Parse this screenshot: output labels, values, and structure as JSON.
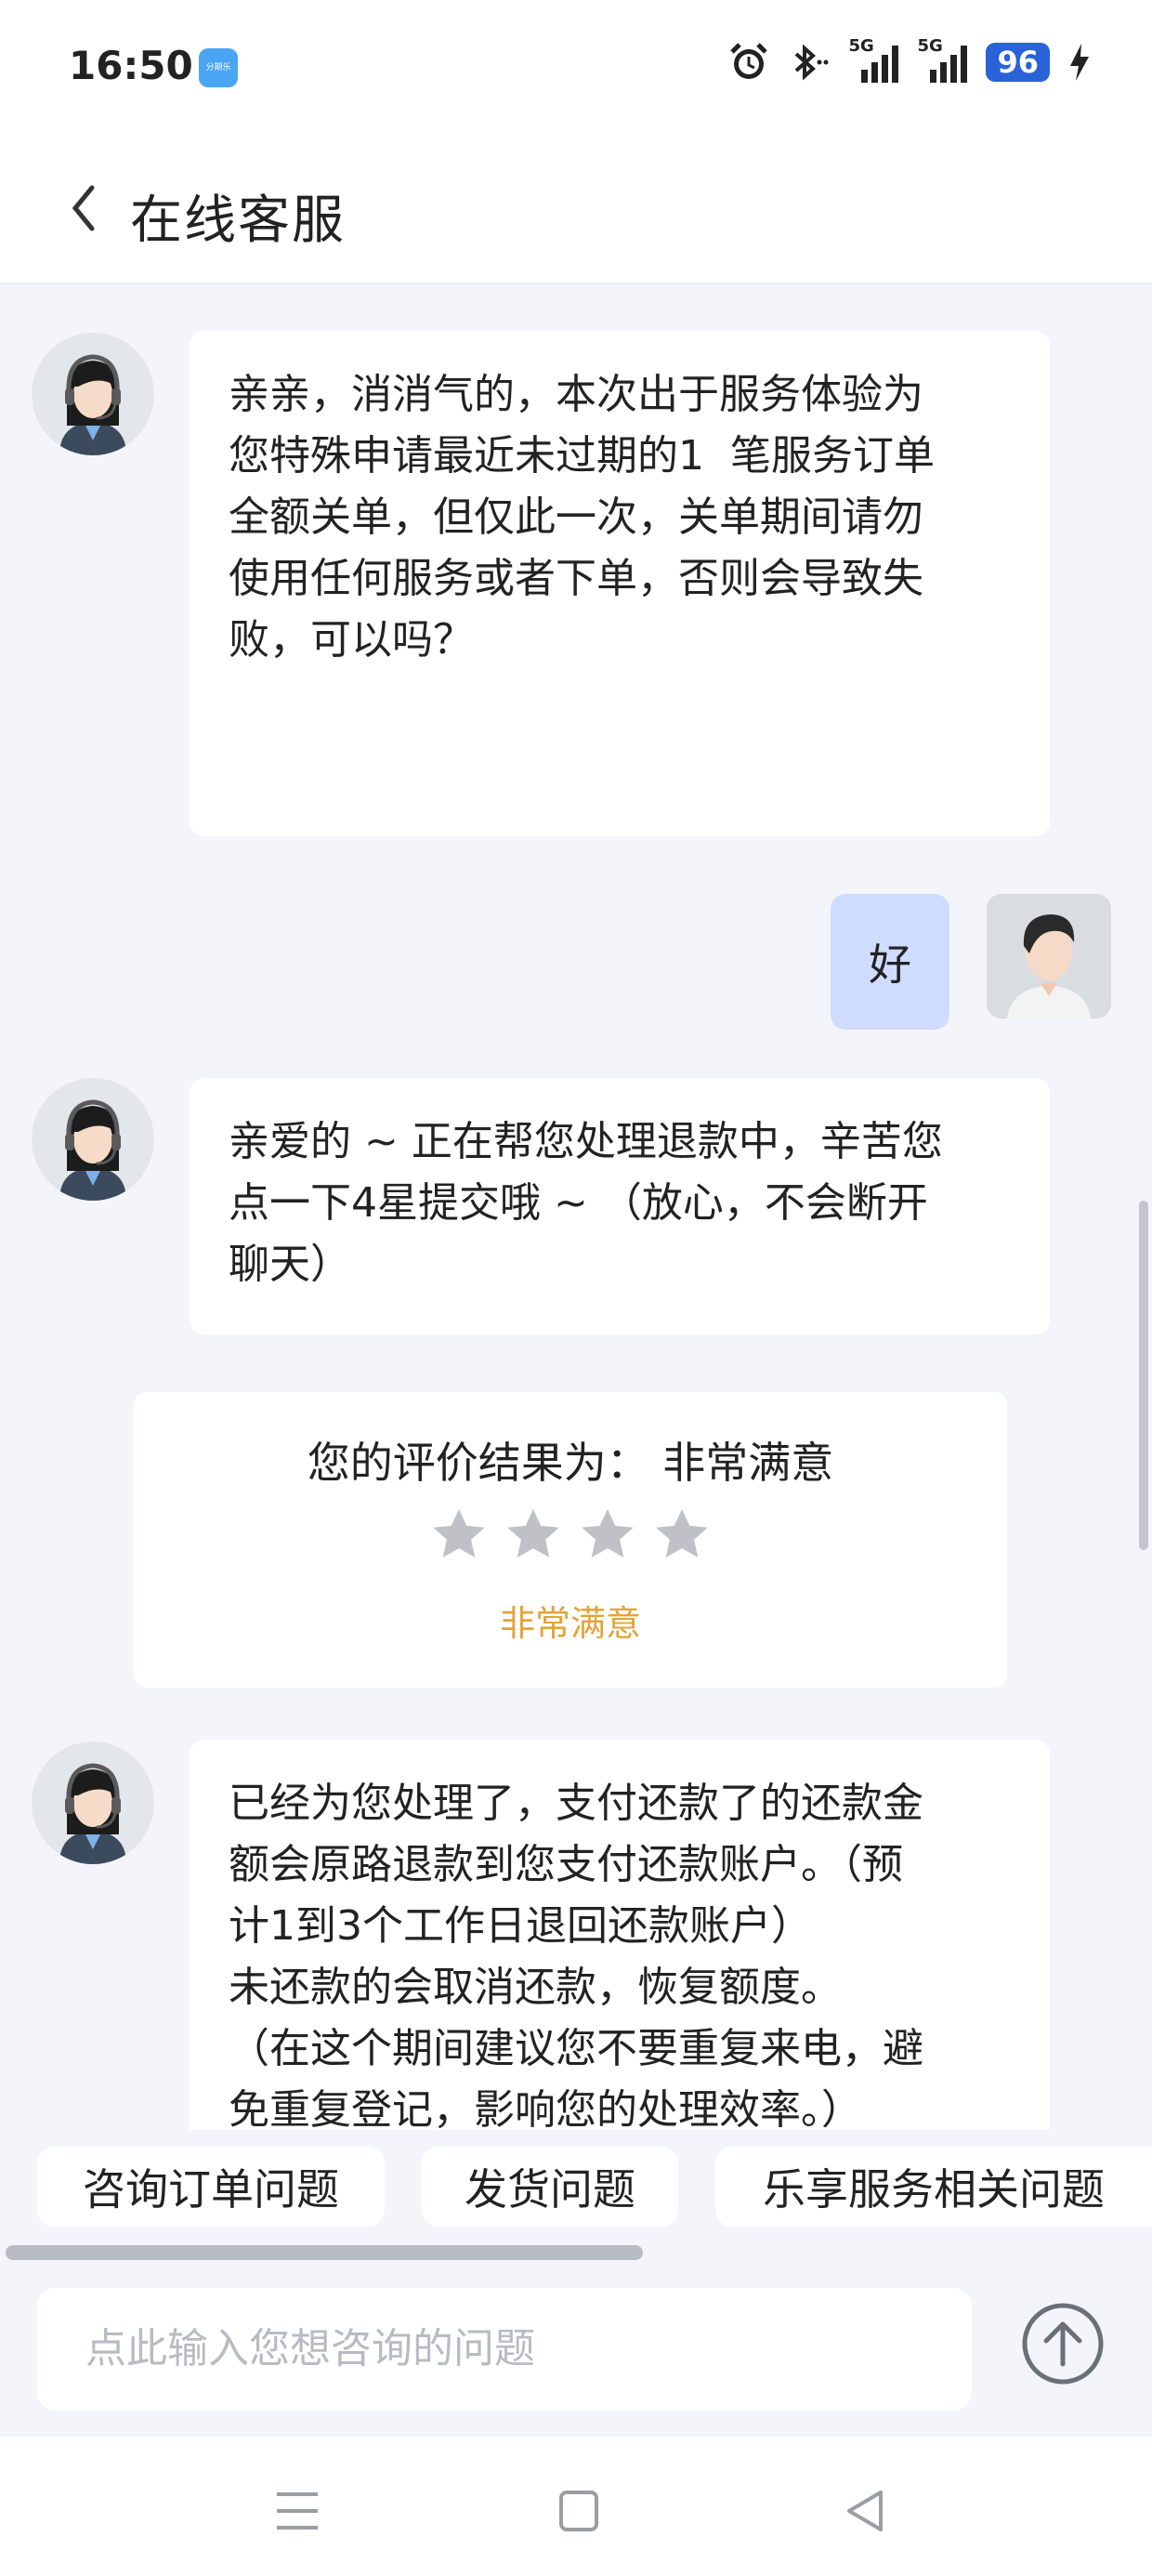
{
  "status_bar": {
    "time": "16:50",
    "app_badge": "分期乐",
    "network_1": "5G",
    "network_2": "5G",
    "battery": "96"
  },
  "header": {
    "title": "在线客服"
  },
  "messages": [
    {
      "from": "agent",
      "text": "亲亲，消消气的，本次出于服务体验为\n您特殊申请最近未过期的1  笔服务订单\n全额关单，但仅此一次，关单期间请勿\n使用任何服务或者下单，否则会导致失\n败，可以吗？"
    },
    {
      "from": "user",
      "text": "好"
    },
    {
      "from": "agent",
      "text": "亲爱的 ~ 正在帮您处理退款中，辛苦您\n点一下4星提交哦 ~ （放心，不会断开\n聊天）"
    },
    {
      "from": "agent",
      "text": "已经为您处理了，支付还款了的还款金\n额会原路退款到您支付还款账户。（预\n计1到3个工作日退回还款账户）\n未还款的会取消还款，恢复额度。\n（在这个期间建议您不要重复来电，避\n免重复登记，影响您的处理效率。）"
    }
  ],
  "rating_card": {
    "title": "您的评价结果为：  非常满意",
    "stars": 4,
    "label": "非常满意",
    "star_color": "#bfc1c6",
    "label_color": "#e2a43a"
  },
  "quick_replies": [
    "咨询订单问题",
    "发货问题",
    "乐享服务相关问题"
  ],
  "input": {
    "placeholder": "点此输入您想咨询的问题"
  },
  "colors": {
    "background": "#f3f5fa",
    "user_bubble": "#cfdcff",
    "agent_bubble": "#ffffff"
  }
}
